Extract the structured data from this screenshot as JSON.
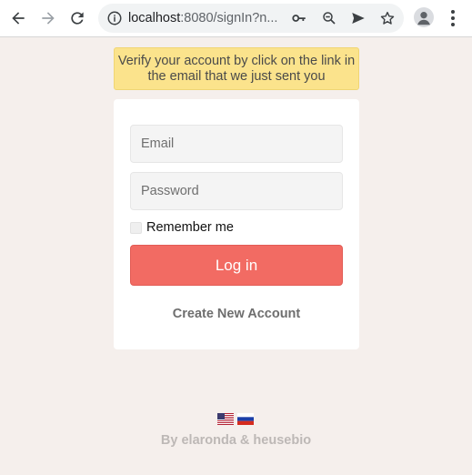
{
  "browser": {
    "url_host": "localhost",
    "url_path": ":8080/signIn?n..."
  },
  "page": {
    "alert_text": "Verify your account by click on the link in the email that we just sent you",
    "email_placeholder": "Email",
    "password_placeholder": "Password",
    "remember_label": "Remember me",
    "login_label": "Log in",
    "create_account_label": "Create New Account",
    "footer_text": "By elaronda & heusebio"
  },
  "colors": {
    "background": "#f5efec",
    "alert": "#fbe38c",
    "login_button": "#f26b63"
  },
  "icons": {
    "back": "arrow-left-icon",
    "forward": "arrow-right-icon",
    "reload": "reload-icon",
    "info": "info-icon",
    "key": "key-icon",
    "zoom": "zoom-out-icon",
    "send": "send-icon",
    "bookmark": "star-icon",
    "profile": "avatar-icon",
    "menu": "kebab-menu-icon",
    "flag_en": "us-flag-icon",
    "flag_ru": "russia-flag-icon"
  }
}
